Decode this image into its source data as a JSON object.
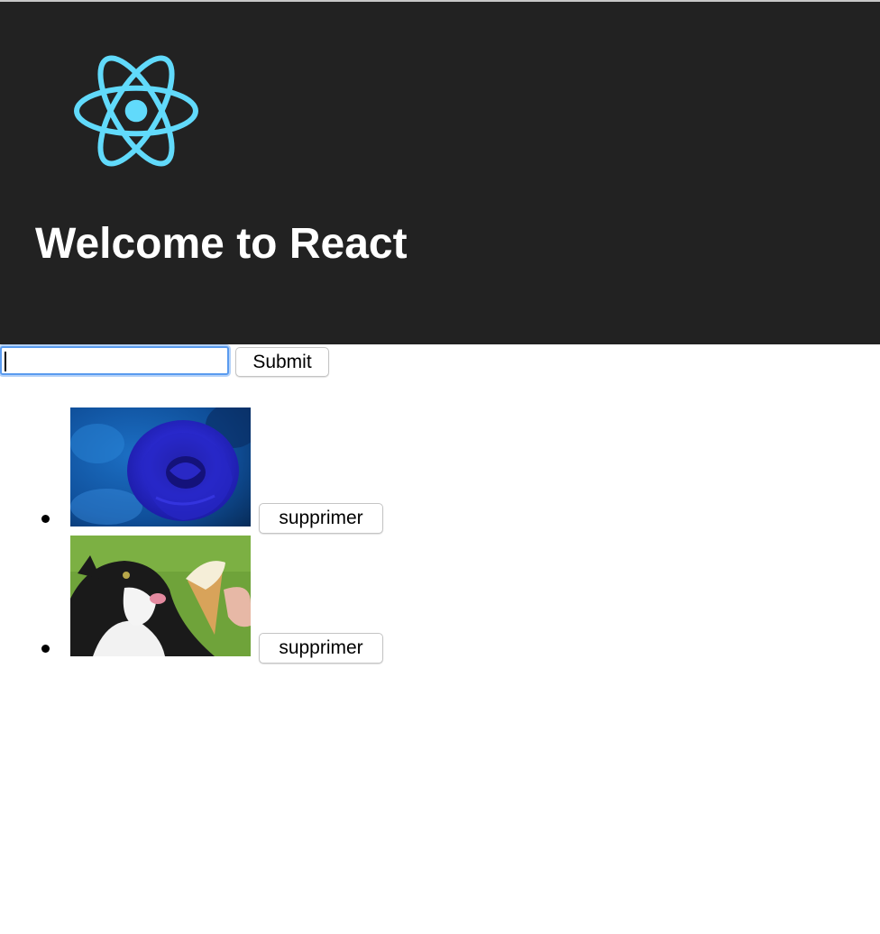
{
  "header": {
    "logo_icon": "react-atom-logo",
    "logo_color": "#61dafb",
    "background_color": "#222222",
    "title": "Welcome to React"
  },
  "form": {
    "input_value": "",
    "submit_label": "Submit"
  },
  "items": [
    {
      "image": "blue-rose-photo",
      "delete_label": "supprimer"
    },
    {
      "image": "cat-licking-ice-cream-photo",
      "delete_label": "supprimer"
    }
  ]
}
